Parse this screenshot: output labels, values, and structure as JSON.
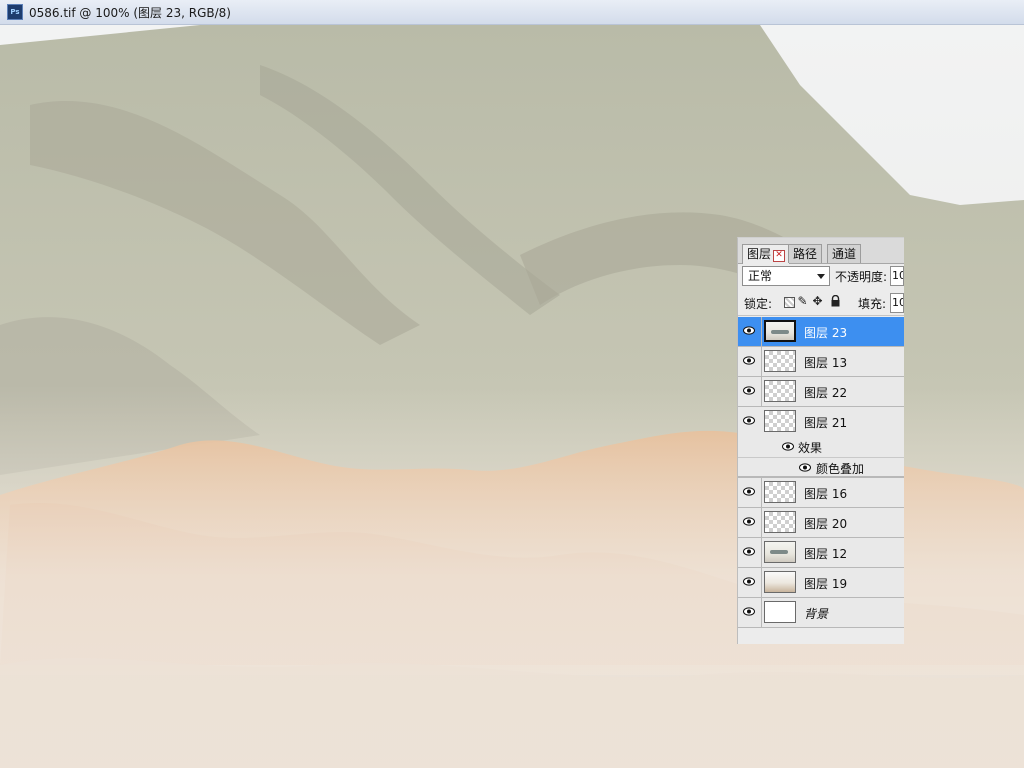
{
  "window": {
    "app_icon": "photoshop-icon",
    "app_icon_text": "Ps",
    "title": "0586.tif @ 100% (图层 23, RGB/8)"
  },
  "panel": {
    "tabs": [
      {
        "label": "图层",
        "active": true
      },
      {
        "label": "路径",
        "active": false
      },
      {
        "label": "通道",
        "active": false
      }
    ],
    "blend_mode": "正常",
    "opacity_label": "不透明度:",
    "opacity_value": "10",
    "lock_label": "锁定:",
    "lock_icons": [
      "lock-transparent-pixels-icon",
      "lock-image-pixels-icon",
      "lock-position-icon",
      "lock-all-icon"
    ],
    "fill_label": "填充:",
    "fill_value": "10",
    "layers": [
      {
        "name": "图层 23",
        "visible": true,
        "selected": true
      },
      {
        "name": "图层 13",
        "visible": true
      },
      {
        "name": "图层 22",
        "visible": true
      },
      {
        "name": "图层 21",
        "visible": true,
        "effects_label": "效果",
        "effect_item": "颜色叠加"
      },
      {
        "name": "图层 16",
        "visible": true
      },
      {
        "name": "图层 20",
        "visible": true
      },
      {
        "name": "图层 12",
        "visible": true
      },
      {
        "name": "图层 19",
        "visible": true
      },
      {
        "name": "背景",
        "visible": true
      }
    ]
  },
  "colors": {
    "selection": "#3d8ff0",
    "panel_bg": "#ececec"
  }
}
